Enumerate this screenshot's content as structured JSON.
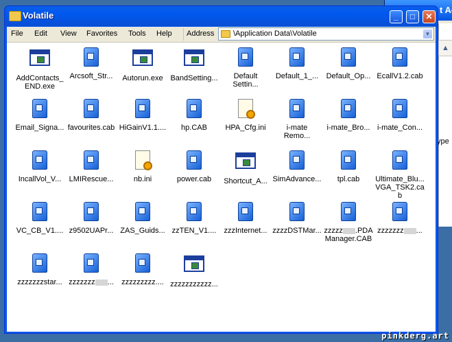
{
  "window": {
    "title": "Volatile",
    "buttons": {
      "minimize": "_",
      "maximize": "□",
      "close": "✕"
    }
  },
  "background_window": {
    "title_fragment": "t Ac",
    "side_label": "ype"
  },
  "menu": [
    "File",
    "Edit",
    "View",
    "Favorites",
    "Tools",
    "Help"
  ],
  "address": {
    "label": "Address",
    "path": "\\Application Data\\Volatile",
    "folder_icon": "folder-icon"
  },
  "files": [
    {
      "name": "AddContacts_\nEND.exe",
      "type": "exe"
    },
    {
      "name": "Arcsoft_Str...",
      "type": "cab"
    },
    {
      "name": "Autorun.exe",
      "type": "exe"
    },
    {
      "name": "BandSetting...",
      "type": "exe"
    },
    {
      "name": "Default\nSettin...",
      "type": "cab"
    },
    {
      "name": "Default_1_...",
      "type": "cab"
    },
    {
      "name": "Default_Op...",
      "type": "cab"
    },
    {
      "name": "EcallV1.2.cab",
      "type": "cab"
    },
    {
      "name": "Email_Signa...",
      "type": "cab"
    },
    {
      "name": "favourites.cab",
      "type": "cab"
    },
    {
      "name": "HiGainV1.1....",
      "type": "cab"
    },
    {
      "name": "hp.CAB",
      "type": "cab"
    },
    {
      "name": "HPA_Cfg.ini",
      "type": "ini"
    },
    {
      "name": "i-mate\nRemo...",
      "type": "cab"
    },
    {
      "name": "i-mate_Bro...",
      "type": "cab"
    },
    {
      "name": "i-mate_Con...",
      "type": "cab"
    },
    {
      "name": "IncallVol_V...",
      "type": "cab"
    },
    {
      "name": "LMIRescue...",
      "type": "cab"
    },
    {
      "name": "nb.ini",
      "type": "ini"
    },
    {
      "name": "power.cab",
      "type": "cab"
    },
    {
      "name": "Shortcut_A...",
      "type": "exe"
    },
    {
      "name": "SimAdvance...",
      "type": "cab"
    },
    {
      "name": "tpl.cab",
      "type": "cab"
    },
    {
      "name": "Ultimate_Blu...\nVGA_TSK2.cab",
      "type": "cab"
    },
    {
      "name": "VC_CB_V1....",
      "type": "cab"
    },
    {
      "name": "z9502UAPr...",
      "type": "cab"
    },
    {
      "name": "ZAS_Guids...",
      "type": "cab"
    },
    {
      "name": "zzTEN_V1....",
      "type": "cab"
    },
    {
      "name": "zzzInternet...",
      "type": "cab"
    },
    {
      "name": "zzzzDSTMar...",
      "type": "cab"
    },
    {
      "name": "zzzzz▒.PDA\nManager.CAB",
      "type": "cab"
    },
    {
      "name": "zzzzzzz▒...",
      "type": "cab"
    },
    {
      "name": "zzzzzzzstar...",
      "type": "cab"
    },
    {
      "name": "zzzzzzz▒...",
      "type": "cab"
    },
    {
      "name": "zzzzzzzzz....",
      "type": "cab"
    },
    {
      "name": "zzzzzzzzzzz...",
      "type": "exe"
    }
  ],
  "watermark": "pinkderg.art"
}
